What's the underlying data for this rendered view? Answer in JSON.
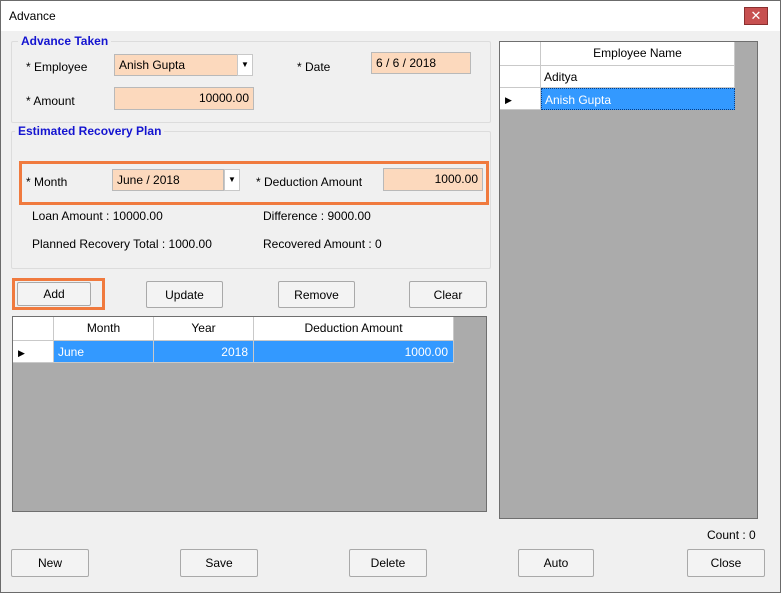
{
  "window": {
    "title": "Advance",
    "close_glyph": "✕"
  },
  "advance_taken": {
    "title": "Advance Taken",
    "employee_label": "* Employee",
    "employee_value": "Anish Gupta",
    "date_label": "* Date",
    "date_value": "6 / 6 / 2018",
    "amount_label": "* Amount",
    "amount_value": "10000.00"
  },
  "recovery_plan": {
    "title": "Estimated Recovery Plan",
    "month_label": "* Month",
    "month_value": "June / 2018",
    "deduction_label": "* Deduction Amount",
    "deduction_value": "1000.00",
    "loan_amount": "Loan Amount : 10000.00",
    "difference": "Difference : 9000.00",
    "planned_total": "Planned Recovery Total : 1000.00",
    "recovered_amount": "Recovered Amount : 0"
  },
  "plan_buttons": {
    "add": "Add",
    "update": "Update",
    "remove": "Remove",
    "clear": "Clear"
  },
  "plan_grid": {
    "columns": [
      "Month",
      "Year",
      "Deduction Amount"
    ],
    "rows": [
      {
        "month": "June",
        "year": "2018",
        "deduction": "1000.00"
      }
    ]
  },
  "employee_grid": {
    "column": "Employee Name",
    "rows": [
      "Aditya",
      "Anish Gupta"
    ]
  },
  "count_label": "Count : 0",
  "bottom_buttons": {
    "new": "New",
    "save": "Save",
    "delete": "Delete",
    "auto": "Auto",
    "close": "Close"
  },
  "colors": {
    "highlight": "#f07a3e",
    "selection": "#3399ff",
    "field_bg": "#fcd9bd",
    "group_title": "#1414d0"
  },
  "icons": {
    "combo_arrow": "▼",
    "row_pointer": "▶"
  }
}
